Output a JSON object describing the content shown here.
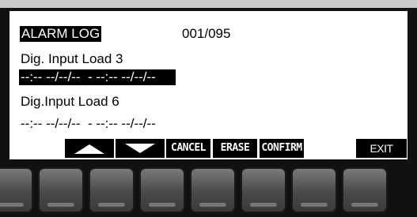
{
  "screen": {
    "title": "ALARM LOG",
    "counter": "001/095",
    "entries": [
      {
        "name": "Dig. Input Load 3",
        "timestamp": "--:-- --/--/--  - --:-- --/--/--",
        "selected": true
      },
      {
        "name": "Dig.Input Load 6",
        "timestamp": "--:-- --/--/--  - --:-- --/--/--",
        "selected": false
      }
    ]
  },
  "softkeys": {
    "up_icon": "triangle-up-icon",
    "down_icon": "triangle-down-icon",
    "cancel": "CANCEL",
    "erase": "ERASE",
    "confirm": "CONFIRM",
    "exit": "EXIT"
  },
  "hardkeys": {
    "count": 8
  }
}
